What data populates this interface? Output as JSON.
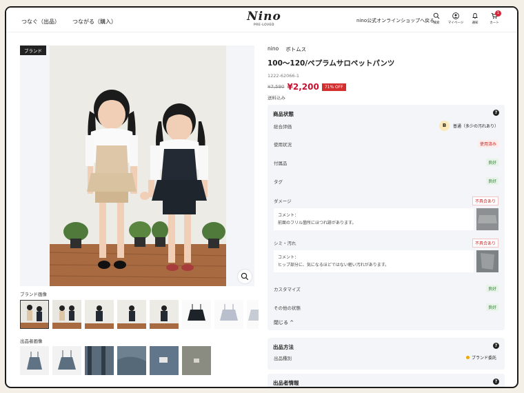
{
  "header": {
    "nav": [
      "つなぐ（出品）",
      "つながる（購入）"
    ],
    "logo": "Nino",
    "logo_sub": "PRE-LOVED",
    "shop_link": "nino公式オンラインショップへ戻る",
    "icons": [
      {
        "name": "search",
        "label": "検索"
      },
      {
        "name": "mypage",
        "label": "マイページ"
      },
      {
        "name": "notification",
        "label": "通知"
      },
      {
        "name": "cart",
        "label": "カート"
      }
    ],
    "cart_count": "1"
  },
  "gallery": {
    "brand_tag": "ブランド",
    "brand_images_label": "ブランド画像",
    "seller_images_label": "出品者画像",
    "brand_thumb_count": 8,
    "seller_thumb_count": 6
  },
  "product": {
    "brand": "nino",
    "category": "ボトムス",
    "title": "100〜120/ペプラムサロペットパンツ",
    "sku": "1222-62066-1",
    "old_price": "¥7,590",
    "price": "¥2,200",
    "discount": "71% OFF",
    "shipping": "送料込み"
  },
  "condition": {
    "heading": "商品状態",
    "help": "?",
    "overall": {
      "label": "総合評価",
      "grade": "B",
      "text": "普通（多少の汚れあり）"
    },
    "rows": [
      {
        "label": "使用状況",
        "value": "使用済み",
        "status": "used"
      },
      {
        "label": "付属品",
        "value": "良好",
        "status": "good"
      },
      {
        "label": "タグ",
        "value": "良好",
        "status": "good"
      }
    ],
    "damage": {
      "label": "ダメージ",
      "value": "不具合あり",
      "comment_label": "コメント：",
      "comment": "前面のフリル箇所にほつれ跡があります。"
    },
    "stain": {
      "label": "シミ・汚れ",
      "value": "不具合あり",
      "comment_label": "コメント：",
      "comment": "ヒップ部分に、気になるほどではない軽い汚れがあります。"
    },
    "customize": {
      "label": "カスタマイズ",
      "value": "良好"
    },
    "other": {
      "label": "その他の状態",
      "value": "良好"
    },
    "close": "閉じる ^"
  },
  "listing": {
    "heading": "出品方法",
    "help": "?",
    "type_label": "出品種別",
    "type_value": "ブランド委託",
    "dot_color": "#f0a800"
  },
  "seller": {
    "heading": "出品者情報",
    "help": "?"
  },
  "colors": {
    "accent_red": "#c8102e",
    "good_green": "#2e7d32",
    "panel_bg": "#f4f5f8"
  }
}
